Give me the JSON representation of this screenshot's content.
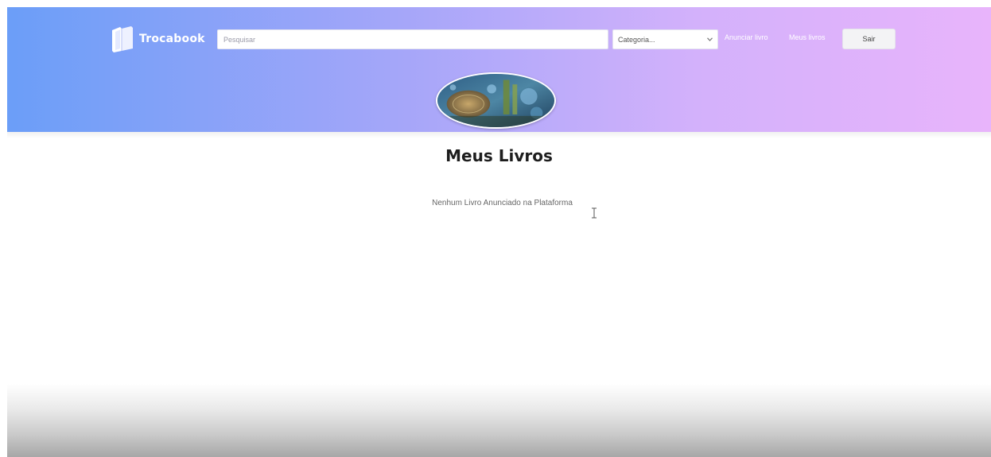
{
  "header": {
    "brand": "Trocabook",
    "search": {
      "placeholder": "Pesquisar",
      "value": ""
    },
    "category": {
      "selected": "Categoria..."
    },
    "links": {
      "anunciar": "Anunciar livro",
      "meus_livros": "Meus livros"
    },
    "logout_label": "Sair"
  },
  "main": {
    "title": "Meus Livros",
    "empty_message": "Nenhum Livro Anunciado na Plataforma"
  },
  "colors": {
    "header_gradient_start": "#6b9ef8",
    "header_gradient_end": "#e8b4fb",
    "title_text": "#1d1d1d"
  },
  "icons": {
    "brand": "book-stack-icon",
    "category": "chevron-down-icon",
    "cursor": "text-cursor-icon"
  }
}
